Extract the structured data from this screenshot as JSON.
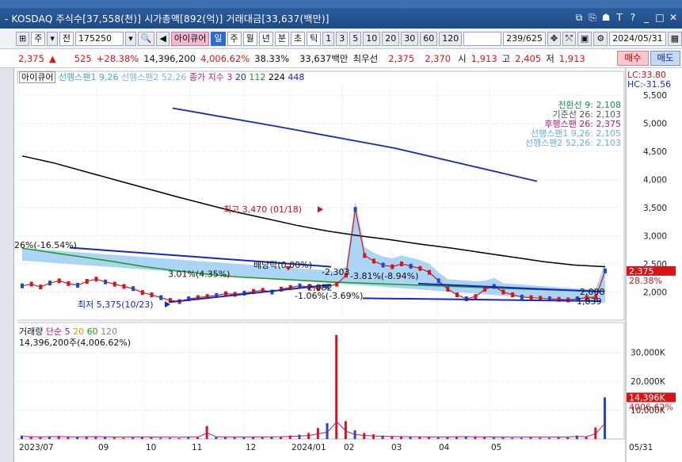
{
  "window": {
    "title": "- KOSDAQ 주식수[37,558(천)] 시가총액[892(억)] 거래대금[33,637(백만)]"
  },
  "toolbar": {
    "code": "175250",
    "name": "아이큐어",
    "counter": "239/625",
    "date": "2024/05/31",
    "labels": [
      "주",
      "전"
    ],
    "periods": [
      "일",
      "주",
      "월",
      "년",
      "분",
      "초",
      "틱"
    ],
    "nums": [
      "1",
      "3",
      "5",
      "10",
      "20",
      "30",
      "60",
      "120"
    ]
  },
  "quote": {
    "price": "2,375",
    "change": "525",
    "pct": "+28.38%",
    "volume": "14,396,200",
    "vol_pct": "4,006.62%",
    "turnover": "38.33%",
    "amount": "33,637백만",
    "best_ask_label": "최우선",
    "best_ask": "2,375",
    "best_bid": "2,370",
    "open_label": "시",
    "open": "1,913",
    "high_label": "고",
    "high": "2,405",
    "low_label": "저",
    "low": "1,913",
    "buy": "매수",
    "sell": "매도"
  },
  "legend": {
    "name": "아이큐어",
    "lead1": "선행스팬1 9,26",
    "lead2": "선행스팬2 52,26",
    "ma_label": "종가 지수 3",
    "ma_vals": [
      "20",
      "112",
      "224",
      "448"
    ],
    "vol_label": "거래량",
    "vol_ma": "단순 5",
    "vol_vals": [
      "20",
      "60",
      "120"
    ],
    "vol_info": "14,396,200주(4,006.62%)"
  },
  "ichimoku_box": [
    "전환선 9: 2,108",
    "기준선 26: 2,103",
    "후행스팬 26: 2,375",
    "선행스팬1 9,26: 2,105",
    "선행스팬2 52,26: 2,103"
  ],
  "lc": "LC:33.80",
  "hc": "HC:-31.56",
  "annotations": {
    "high": "최고 3,470 (01/18)",
    "low": "최저 5,375(10/23)",
    "div": "배당락(0.00%)",
    "a1": "3.01%(4.35%)",
    "a2": "-2,303",
    "a3": "-3.81%(-8.94%)",
    "a4": "-1.06%(-3.69%)",
    "a5": "2,082",
    "a6": "5,375(10/23)",
    "pctleft": "26%(-16.54%)",
    "end1": "2,008",
    "end2": "1,839"
  },
  "price_badge": {
    "price": "2,375",
    "pct": "28.38%"
  },
  "vol_badge": {
    "vol": "14,396K",
    "pct": "4006.62%"
  },
  "colors": {
    "ma20": "#1a9a1a",
    "ma112": "#000000",
    "ma224": "#1428c8",
    "cloud": "#8fc6f2",
    "up": "#d4161b",
    "down": "#1f49c6"
  },
  "chart_data": {
    "type": "line",
    "price_axis": {
      "ticks": [
        "5,500",
        "5,000",
        "4,500",
        "4,000",
        "3,500",
        "3,000",
        "2,500",
        "2,000"
      ],
      "min": 1500,
      "max": 5700
    },
    "volume_axis": {
      "ticks": [
        "30,000K",
        "20,000K",
        "10,000K"
      ],
      "max": 37000000
    },
    "x_ticks": [
      "2023/07",
      "09",
      "10",
      "11",
      "12",
      "2024/01",
      "02",
      "03",
      "04",
      "05",
      "05/31"
    ],
    "close_series": [
      2110,
      2140,
      2090,
      2160,
      2200,
      2150,
      2120,
      2190,
      2230,
      2180,
      2140,
      2100,
      2060,
      1990,
      1950,
      1900,
      1850,
      1830,
      1880,
      1900,
      1920,
      1940,
      1970,
      1960,
      1980,
      2010,
      2030,
      2000,
      2050,
      2080,
      2110,
      2090,
      2060,
      2100,
      2140,
      2300,
      3470,
      2650,
      2550,
      2480,
      2450,
      2500,
      2460,
      2420,
      2350,
      2200,
      2050,
      1950,
      1880,
      1920,
      2050,
      2100,
      2000,
      1950,
      1910,
      1900,
      1890,
      1880,
      1870,
      1860,
      1880,
      1900,
      1913,
      2375
    ],
    "volume_series": [
      1.2,
      0.8,
      0.6,
      0.9,
      1.0,
      0.7,
      0.6,
      0.8,
      0.9,
      0.7,
      0.5,
      0.4,
      0.5,
      0.6,
      0.5,
      0.4,
      0.4,
      0.3,
      0.5,
      0.6,
      4.5,
      0.7,
      0.6,
      0.6,
      0.5,
      0.6,
      0.5,
      0.7,
      0.8,
      1.2,
      1.5,
      2.1,
      3.8,
      5.5,
      36.0,
      6.2,
      3.0,
      2.1,
      1.6,
      1.2,
      1.0,
      0.9,
      0.8,
      0.7,
      0.6,
      0.5,
      0.6,
      0.8,
      0.9,
      0.7,
      0.6,
      0.5,
      0.5,
      0.4,
      0.4,
      0.5,
      0.4,
      0.4,
      0.5,
      0.6,
      1.2,
      0.8,
      4.0,
      14.4
    ]
  }
}
